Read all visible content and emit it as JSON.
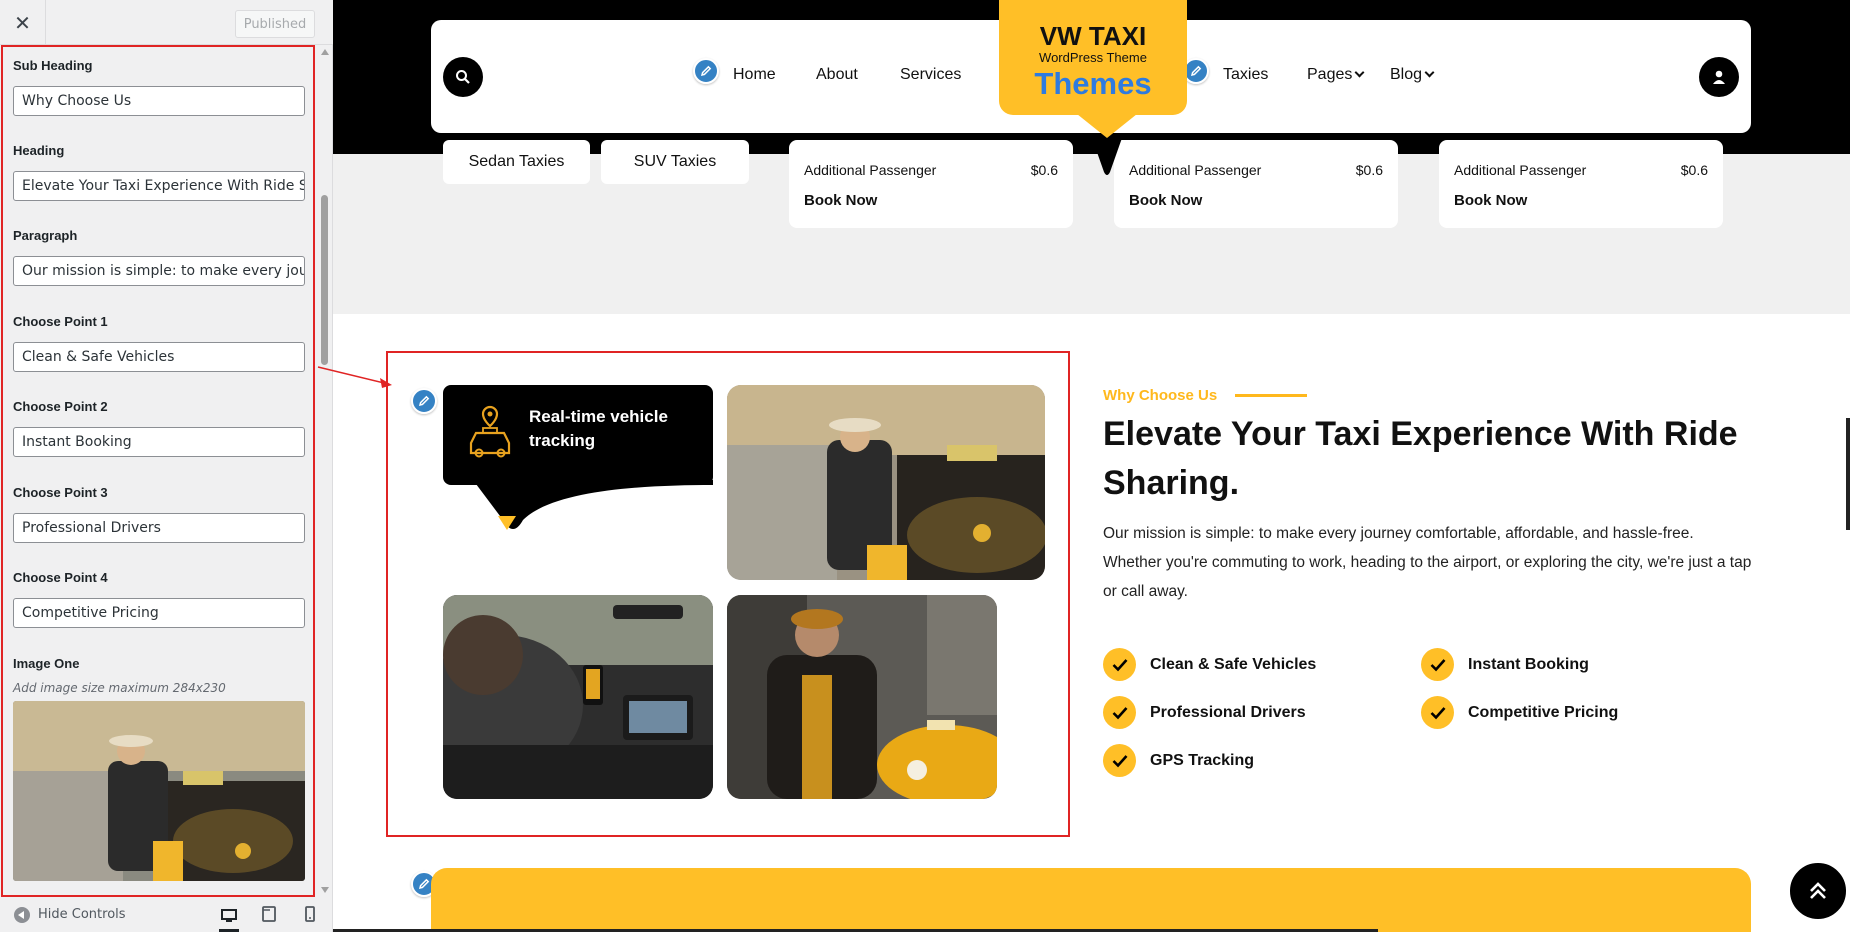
{
  "sidebar": {
    "close_icon": "close-icon",
    "published_label": "Published",
    "fields": [
      {
        "label": "Sub Heading",
        "value": "Why Choose Us"
      },
      {
        "label": "Heading",
        "value": "Elevate Your Taxi Experience With Ride Shar"
      },
      {
        "label": "Paragraph",
        "value": "Our mission is simple: to make every journey"
      },
      {
        "label": "Choose Point 1",
        "value": "Clean & Safe Vehicles"
      },
      {
        "label": "Choose Point 2",
        "value": "Instant Booking"
      },
      {
        "label": "Choose Point 3",
        "value": "Professional Drivers"
      },
      {
        "label": "Choose Point 4",
        "value": "Competitive Pricing"
      }
    ],
    "image_field": {
      "label": "Image One",
      "description": "Add image size maximum 284x230"
    },
    "footer": {
      "hide_controls": "Hide Controls"
    },
    "devices": [
      "desktop-icon",
      "tablet-icon",
      "mobile-icon"
    ]
  },
  "header": {
    "nav_left": [
      "Home",
      "About",
      "Services"
    ],
    "nav_right": [
      "Taxies",
      "Pages",
      "Blog"
    ],
    "logo": {
      "title": "VW TAXI",
      "subtitle": "WordPress Theme",
      "brand": "Themes"
    }
  },
  "pricing_strip": {
    "pills": [
      "Sedan Taxies",
      "SUV Taxies"
    ],
    "cards": [
      {
        "label": "Additional Passenger",
        "price": "$0.6",
        "cta": "Book Now"
      },
      {
        "label": "Additional Passenger",
        "price": "$0.6",
        "cta": "Book Now"
      },
      {
        "label": "Additional Passenger",
        "price": "$0.6",
        "cta": "Book Now"
      }
    ]
  },
  "why_choose": {
    "tracking_card": "Real-time vehicle tracking",
    "sub_heading": "Why Choose Us",
    "heading": "Elevate Your Taxi Experience With Ride Sharing.",
    "paragraph": "Our mission is simple: to make every journey comfortable, affordable, and hassle-free. Whether you're commuting to work, heading to the airport, or exploring the city, we're just a tap or call away.",
    "points": [
      "Clean & Safe Vehicles",
      "Instant Booking",
      "Professional Drivers",
      "Competitive Pricing",
      "GPS Tracking"
    ]
  },
  "colors": {
    "accent": "#ffbf27",
    "link_blue": "#2e7be0",
    "edit_blue": "#3582c4",
    "highlight": "#e02424"
  }
}
